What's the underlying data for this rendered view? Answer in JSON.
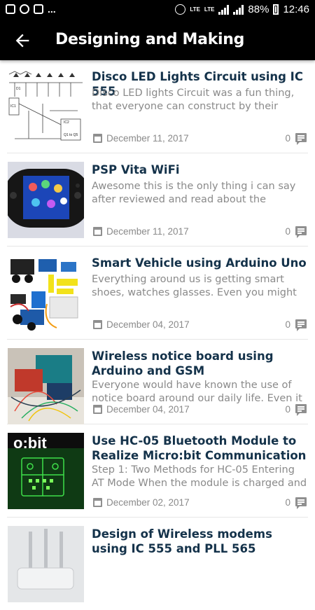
{
  "statusbar": {
    "notification_icons": [
      "gallery-icon",
      "whatsapp-icon",
      "gmail-icon"
    ],
    "more": "...",
    "sim_badge": "2",
    "vo_lte": "LTE",
    "network": "LTE",
    "battery": "88%",
    "time": "12:46"
  },
  "appbar": {
    "title": "Designing and Making"
  },
  "articles": [
    {
      "title": "Disco LED Lights Circuit using IC 555",
      "excerpt": "Disco LED lights Circuit was a fun thing, that everyone can construct by their own.In",
      "date": "December 11, 2017",
      "comments": "0",
      "thumb": "circuit-diagram"
    },
    {
      "title": "PSP Vita WiFi",
      "excerpt": "Awesome this is the only thing i can say after reviewed and read about the features of",
      "date": "December 11, 2017",
      "comments": "0",
      "thumb": "psp-vita"
    },
    {
      "title": "Smart Vehicle using Arduino Uno",
      "excerpt": "Everything around us is getting smart shoes, watches glasses. Even you might have come",
      "date": "December 04, 2017",
      "comments": "0",
      "thumb": "robot-kit"
    },
    {
      "title": "Wireless notice board using Arduino and GSM",
      "excerpt": "Everyone would have known the use of notice board around our daily life. Even it",
      "date": "December 04, 2017",
      "comments": "0",
      "thumb": "arduino-wires"
    },
    {
      "title": "Use HC-05 Bluetooth Module to Realize Micro:bit Communication With",
      "excerpt": "  Step 1: Two Methods for HC-05 Entering AT Mode When the module is charged and",
      "date": "December 02, 2017",
      "comments": "0",
      "thumb": "microbit"
    },
    {
      "title": "Design of Wireless modems using IC 555 and PLL 565",
      "excerpt": "",
      "date": "",
      "comments": "",
      "thumb": "router"
    }
  ]
}
